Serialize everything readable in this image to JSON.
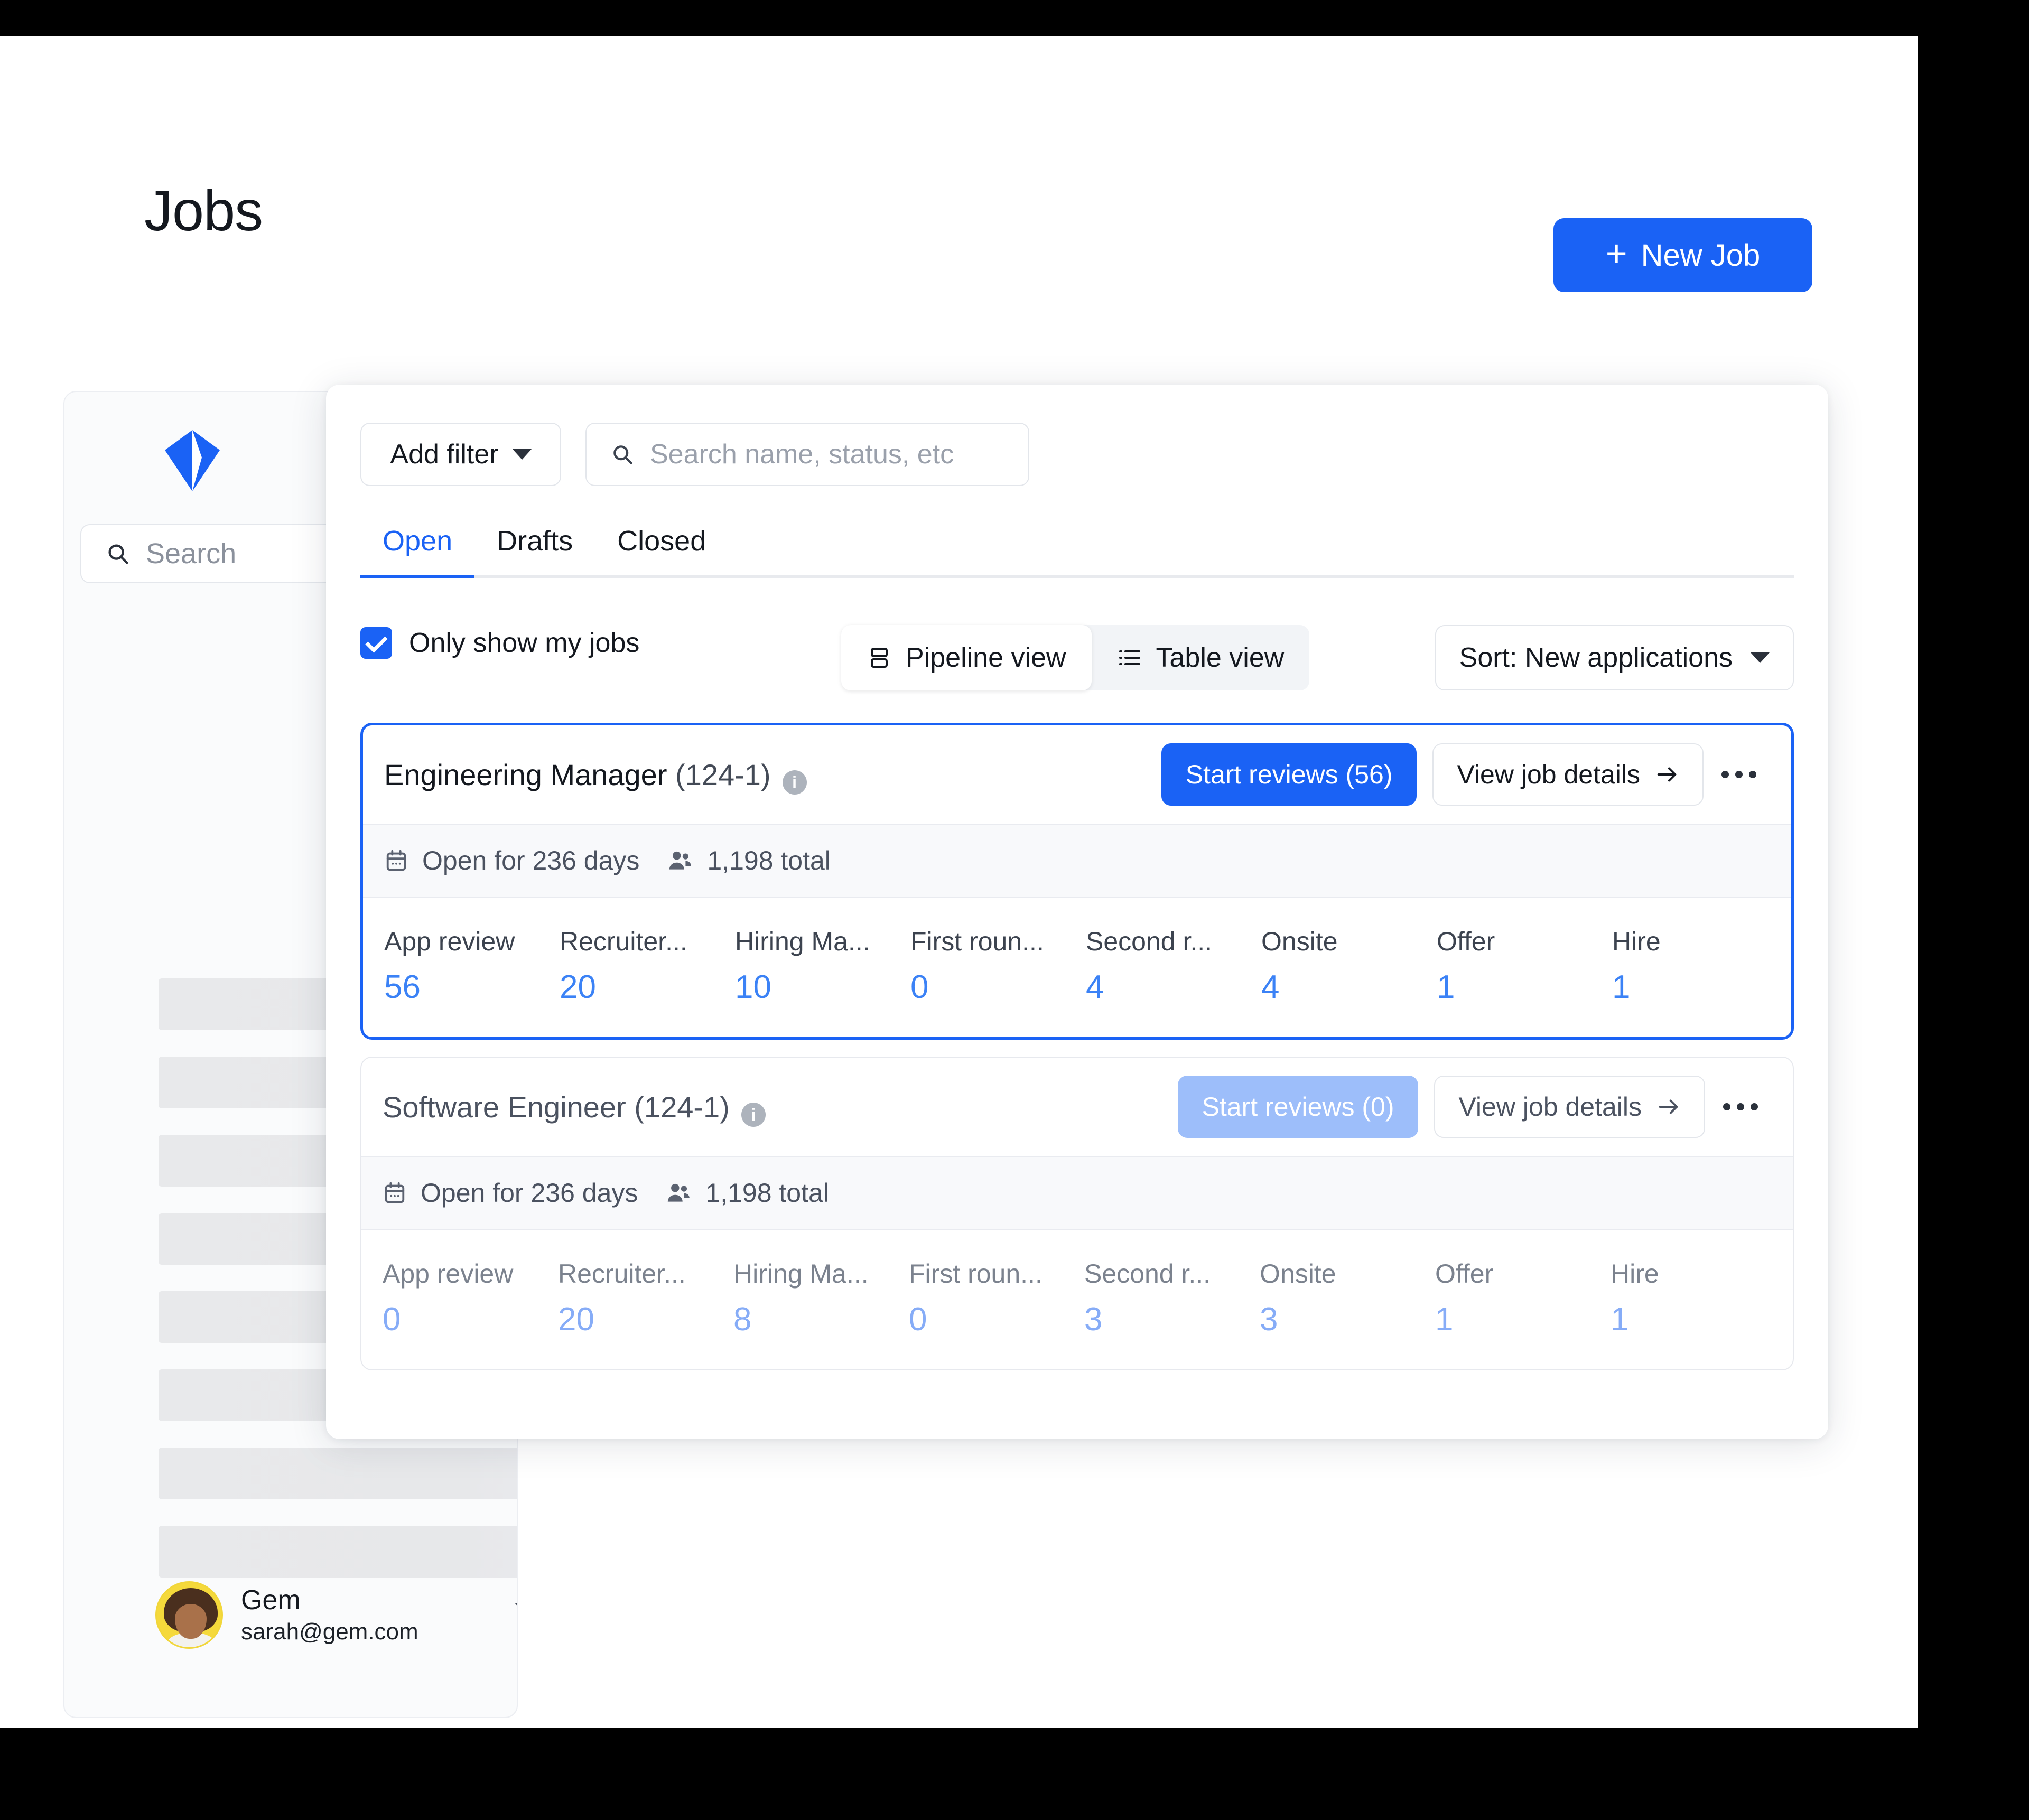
{
  "header": {
    "title": "Jobs",
    "new_job_label": "New Job",
    "new_job_plus": "+",
    "accent_color": "#1a62f5"
  },
  "sidebar": {
    "logo_name": "gem-logo",
    "search_placeholder": "Search",
    "skeleton_rows": 8,
    "user": {
      "name": "Gem",
      "email": "sarah@gem.com"
    }
  },
  "panel": {
    "filters": {
      "add_filter_label": "Add filter",
      "search_placeholder": "Search name, status, etc"
    },
    "tabs": [
      {
        "label": "Open",
        "active": true
      },
      {
        "label": "Drafts",
        "active": false
      },
      {
        "label": "Closed",
        "active": false
      }
    ],
    "controls": {
      "only_show_my_jobs_label": "Only show my jobs",
      "only_show_my_jobs_checked": true,
      "pipeline_view_label": "Pipeline view",
      "table_view_label": "Table view",
      "active_view": "Pipeline view",
      "sort_label": "Sort: New applications"
    },
    "stage_headers": [
      "App review",
      "Recruiter...",
      "Hiring Ma...",
      "First roun...",
      "Second r...",
      "Onsite",
      "Offer",
      "Hire"
    ],
    "jobs": [
      {
        "title": "Engineering Manager",
        "req": "(124-1)",
        "selected": true,
        "start_reviews_label": "Start reviews (56)",
        "start_reviews_disabled": false,
        "view_details_label": "View job details",
        "open_days_label": "Open for 236 days",
        "total_label": "1,198 total",
        "stages": [
          {
            "label": "App review",
            "value": "56"
          },
          {
            "label": "Recruiter...",
            "value": "20"
          },
          {
            "label": "Hiring Ma...",
            "value": "10"
          },
          {
            "label": "First roun...",
            "value": "0"
          },
          {
            "label": "Second r...",
            "value": "4"
          },
          {
            "label": "Onsite",
            "value": "4"
          },
          {
            "label": "Offer",
            "value": "1"
          },
          {
            "label": "Hire",
            "value": "1"
          }
        ]
      },
      {
        "title": "Software Engineer",
        "req": "(124-1)",
        "selected": false,
        "start_reviews_label": "Start reviews (0)",
        "start_reviews_disabled": true,
        "view_details_label": "View job details",
        "open_days_label": "Open for 236 days",
        "total_label": "1,198 total",
        "stages": [
          {
            "label": "App review",
            "value": "0"
          },
          {
            "label": "Recruiter...",
            "value": "20"
          },
          {
            "label": "Hiring Ma...",
            "value": "8"
          },
          {
            "label": "First roun...",
            "value": "0"
          },
          {
            "label": "Second r...",
            "value": "3"
          },
          {
            "label": "Onsite",
            "value": "3"
          },
          {
            "label": "Offer",
            "value": "1"
          },
          {
            "label": "Hire",
            "value": "1"
          }
        ]
      }
    ]
  }
}
